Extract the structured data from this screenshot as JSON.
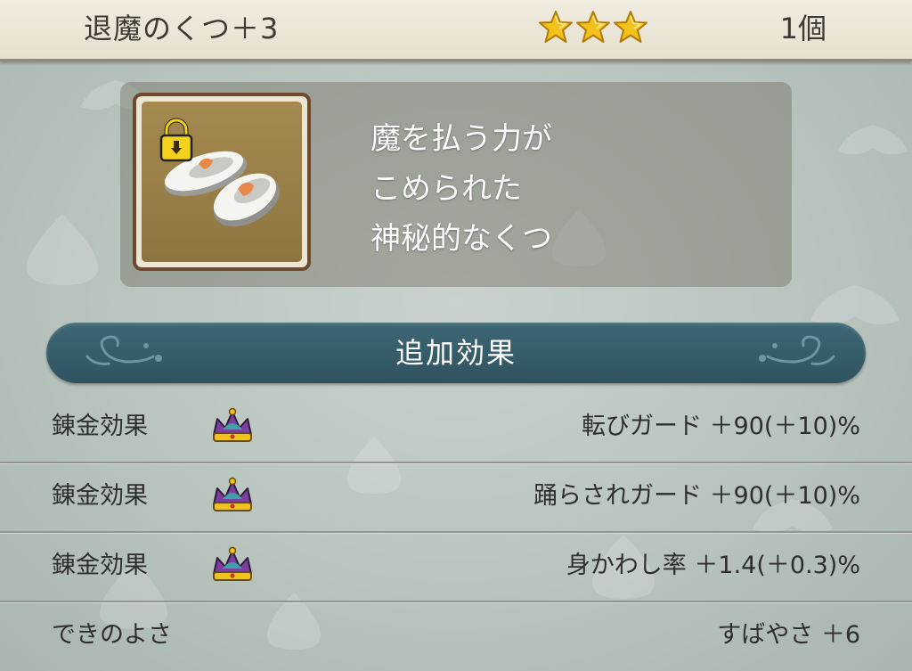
{
  "header": {
    "item_name": "退魔のくつ＋3",
    "star_count": 3,
    "star_color": "#f2c21a",
    "quantity": "1個"
  },
  "item": {
    "icon": "white-shoes-locked-icon",
    "description_lines": [
      "魔を払う力が",
      "こめられた",
      "神秘的なくつ"
    ]
  },
  "section": {
    "title": "追加効果"
  },
  "effects": [
    {
      "label": "錬金効果",
      "icon": "alchemy-crown-icon",
      "value": "転びガード ＋90(＋10)%"
    },
    {
      "label": "錬金効果",
      "icon": "alchemy-crown-icon",
      "value": "踊らされガード ＋90(＋10)%"
    },
    {
      "label": "錬金効果",
      "icon": "alchemy-crown-icon",
      "value": "身かわし率 ＋1.4(＋0.3)%"
    }
  ],
  "quality": {
    "label": "できのよさ",
    "value": "すばやさ ＋6"
  },
  "colors": {
    "banner": "#2f5260",
    "background": "#b9c4bf",
    "header": "#ebe6d7"
  }
}
